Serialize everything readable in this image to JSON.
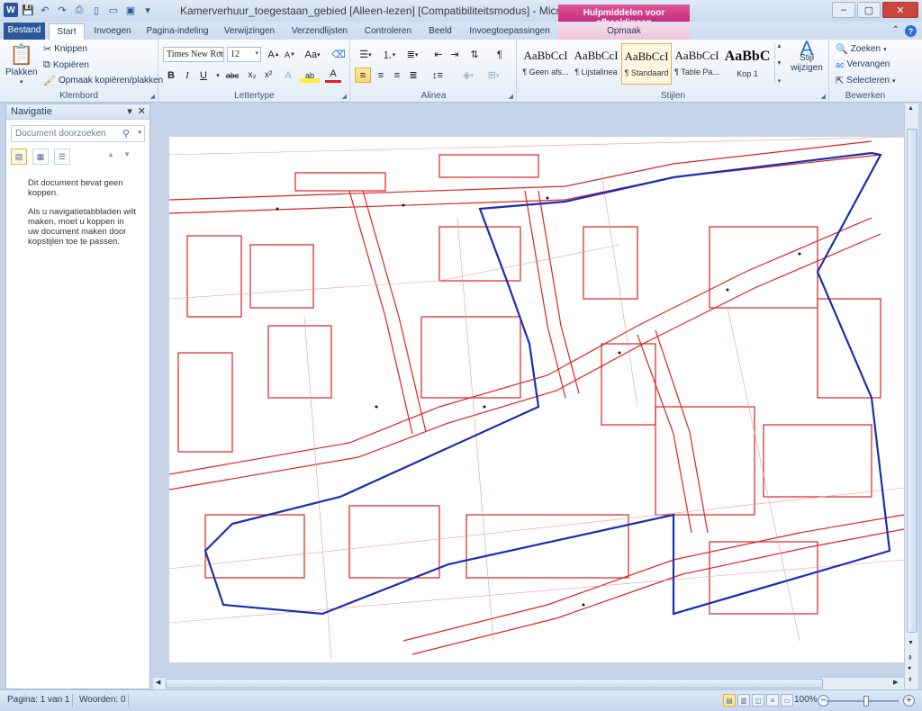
{
  "app": {
    "title": "Kamerverhuur_toegestaan_gebied [Alleen-lezen] [Compatibiliteitsmodus] - Microsoft Word",
    "context_tab_title": "Hulpmiddelen voor afbeeldingen",
    "accent_color": "#2b5797",
    "context_color": "#c52c7c"
  },
  "window_controls": {
    "minimize": "–",
    "maximize": "▢",
    "close": "✕"
  },
  "tabs": {
    "file": "Bestand",
    "items": [
      "Start",
      "Invoegen",
      "Pagina-indeling",
      "Verwijzingen",
      "Verzendlijsten",
      "Controleren",
      "Beeld",
      "Invoegtoepassingen",
      "Opmaak"
    ],
    "active": "Start",
    "help": "?"
  },
  "ribbon": {
    "clipboard": {
      "paste": "Plakken",
      "cut": "Knippen",
      "copy": "Kopiëren",
      "format_painter": "Opmaak kopiëren/plakken",
      "label": "Klembord"
    },
    "font": {
      "family": "Times New Roman",
      "size": "12",
      "case": "Aa",
      "label": "Lettertype",
      "bold": "B",
      "italic": "I",
      "underline": "U",
      "strike": "abc",
      "subscript": "x₂",
      "superscript": "x²"
    },
    "paragraph": {
      "label": "Alinea",
      "pilcrow": "¶"
    },
    "styles": {
      "label": "Stijlen",
      "items": [
        {
          "sample": "AaBbCcI",
          "name": "¶ Geen afs..."
        },
        {
          "sample": "AaBbCcI",
          "name": "¶ Lijstalinea"
        },
        {
          "sample": "AaBbCcI",
          "name": "¶ Standaard"
        },
        {
          "sample": "AaBbCcI",
          "name": "¶ Table Pa..."
        },
        {
          "sample": "AaBbC",
          "name": "Kop 1"
        }
      ],
      "active_index": 2,
      "change_styles": "Stijl wijzigen"
    },
    "editing": {
      "label": "Bewerken",
      "find": "Zoeken",
      "replace": "Vervangen",
      "select": "Selecteren"
    }
  },
  "navigation": {
    "title": "Navigatie",
    "search_placeholder": "Document doorzoeken",
    "message_1": "Dit document bevat geen koppen.",
    "message_2": "Als u navigatietabbladen wilt maken, moet u koppen in uw document maken door kopstijlen toe te passen."
  },
  "status": {
    "page": "Pagina: 1 van 1",
    "words": "Woorden: 0",
    "zoom": "100%"
  },
  "icons": [
    "word-logo-icon",
    "save-icon",
    "undo-icon",
    "redo-icon",
    "paste-icon",
    "scissors-icon",
    "copy-icon",
    "brush-icon",
    "search-icon",
    "close-icon"
  ]
}
